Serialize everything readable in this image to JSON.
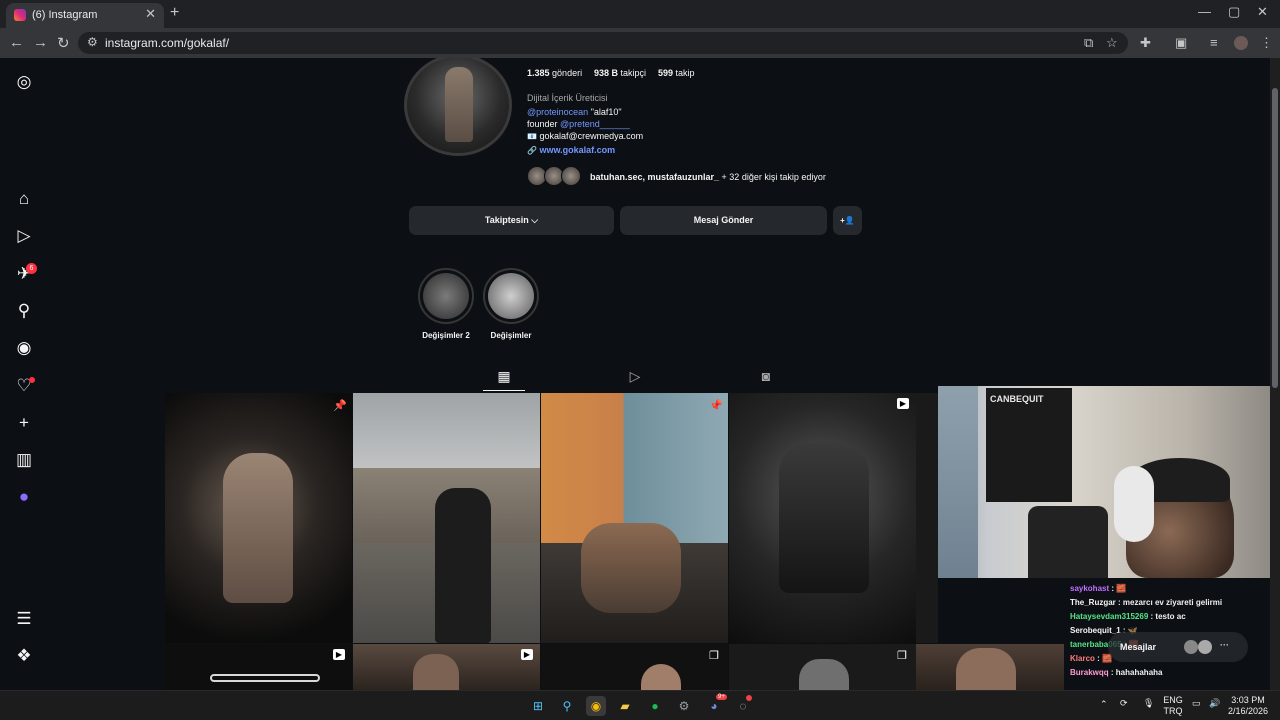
{
  "browser": {
    "tab_title": "(6) Instagram",
    "tab_close": "✕",
    "new_tab": "+",
    "url": "instagram.com/gokalaf/",
    "window": {
      "minimize": "—",
      "maximize": "▢",
      "close": "✕"
    }
  },
  "sidebar": {
    "notifications_badge": "6"
  },
  "profile": {
    "posts_count": "1.385",
    "posts_label": "gönderi",
    "followers_count": "938 B",
    "followers_label": "takipçi",
    "following_count": "599",
    "following_label": "takip",
    "category": "Dijital İçerik Üreticisi",
    "bio_line1_handle": "@proteinocean",
    "bio_line1_text": "\"alaf10\"",
    "bio_line2_prefix": "founder",
    "bio_line2_handle": "@pretend______",
    "bio_email_icon": "📧",
    "bio_email": "gokalaf@crewmedya.com",
    "link_icon": "🔗",
    "website": "www.gokalaf.com",
    "followed_by_names": "batuhan.sec, mustafauzunlar_",
    "followed_by_rest": " + 32 diğer kişi takip ediyor"
  },
  "actions": {
    "following_button": "Takiptesin ⌵",
    "message_button": "Mesaj Gönder",
    "suggest_icon": "+👤"
  },
  "highlights": [
    {
      "label": "Değişimler 2"
    },
    {
      "label": "Değişimler"
    }
  ],
  "tabs": {
    "posts_icon": "▦",
    "reels_icon": "▷",
    "tagged_icon": "◙"
  },
  "webcam": {
    "poster_text": "CANBEQUIT"
  },
  "chat": [
    {
      "user": "saykohast",
      "message": ": 🧱",
      "color": "#c070ff"
    },
    {
      "user": "The_Ruzgar",
      "message": ": mezarcı ev ziyareti gelirmi",
      "color": "#f5f5f5"
    },
    {
      "user": "Hataysevdam315269",
      "message": ": testo ac",
      "color": "#57e389"
    },
    {
      "user": "Serobequit_1",
      "message": ": 🦋",
      "color": "#f5f5f5"
    },
    {
      "user": "tanerbaba065",
      "message": ": 🧱",
      "color": "#57e389"
    },
    {
      "user": "Klarco",
      "message": ": 🧱",
      "color": "#ff7b7b"
    },
    {
      "user": "Burakwqq",
      "message": ": hahahahaha",
      "color": "#ff9bd2"
    }
  ],
  "messages_pill": "Mesajlar",
  "taskbar": {
    "lang_top": "ENG",
    "lang_bottom": "TRQ",
    "time": "3:03 PM",
    "date": "2/16/2026",
    "discord_badge": "9+"
  }
}
